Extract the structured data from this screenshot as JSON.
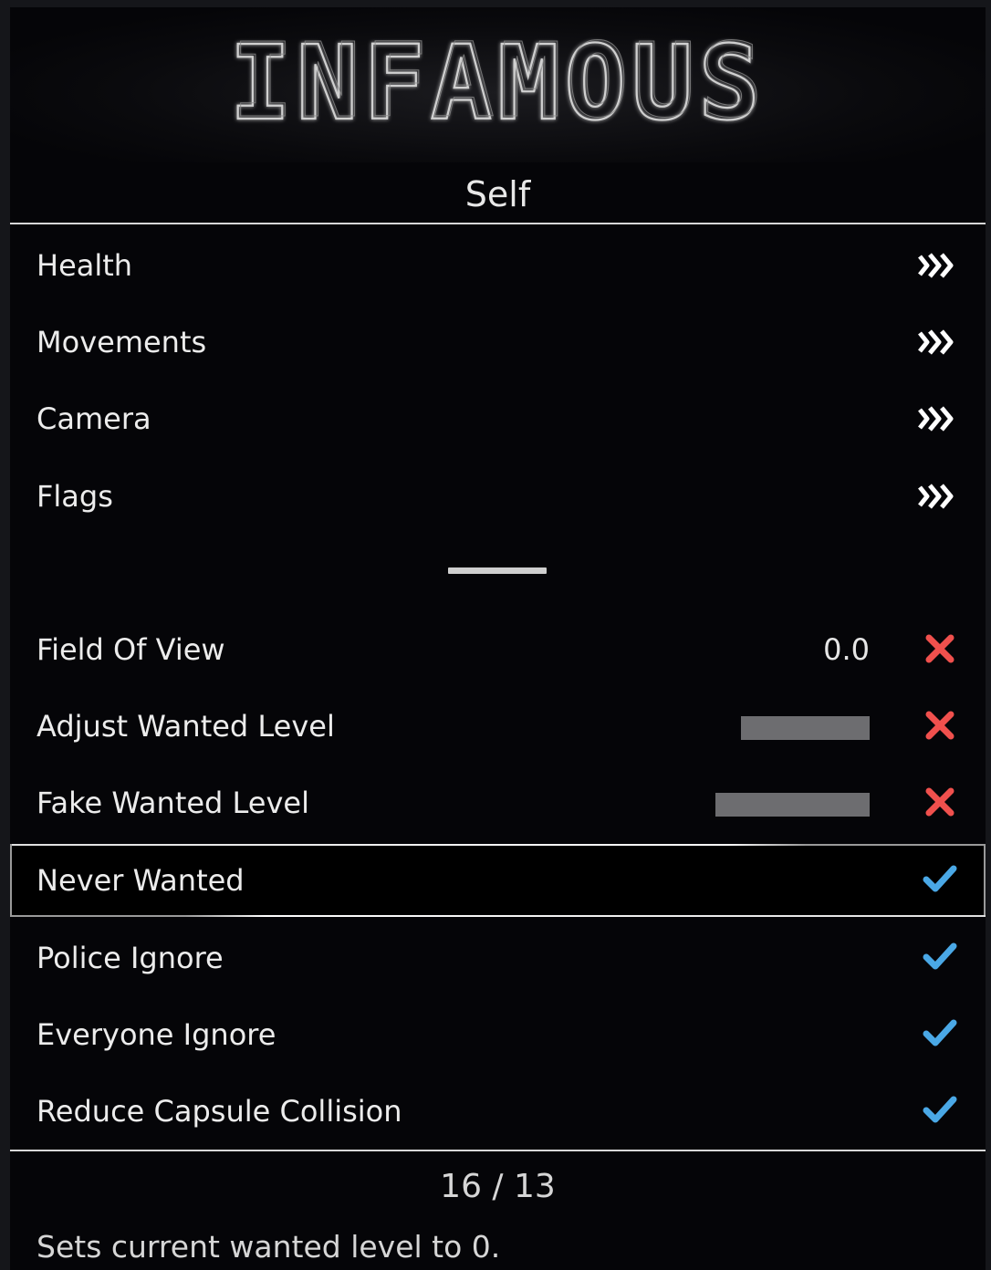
{
  "logo": {
    "text": "INFAMOUS"
  },
  "header": {
    "title": "Self"
  },
  "submenus": [
    {
      "label": "Health",
      "icon": "submenu-chevron-icon"
    },
    {
      "label": "Movements",
      "icon": "submenu-chevron-icon"
    },
    {
      "label": "Camera",
      "icon": "submenu-chevron-icon"
    },
    {
      "label": "Flags",
      "icon": "submenu-chevron-icon"
    }
  ],
  "options": [
    {
      "label": "Field Of View",
      "value": "0.0",
      "state": "off"
    },
    {
      "label": "Adjust Wanted Level",
      "slider_fill": 0.3,
      "state": "off"
    },
    {
      "label": "Fake Wanted Level",
      "slider_fill": 0.36,
      "state": "off"
    },
    {
      "label": "Never Wanted",
      "state": "on",
      "selected": true
    },
    {
      "label": "Police Ignore",
      "state": "on"
    },
    {
      "label": "Everyone Ignore",
      "state": "on"
    },
    {
      "label": "Reduce Capsule Collision",
      "state": "on"
    }
  ],
  "footer": {
    "counter": "16 / 13",
    "description": "Sets current wanted level to 0."
  },
  "colors": {
    "off": "#f0504d",
    "on": "#4aa8e6",
    "background": "#050508",
    "text": "#ececec"
  }
}
